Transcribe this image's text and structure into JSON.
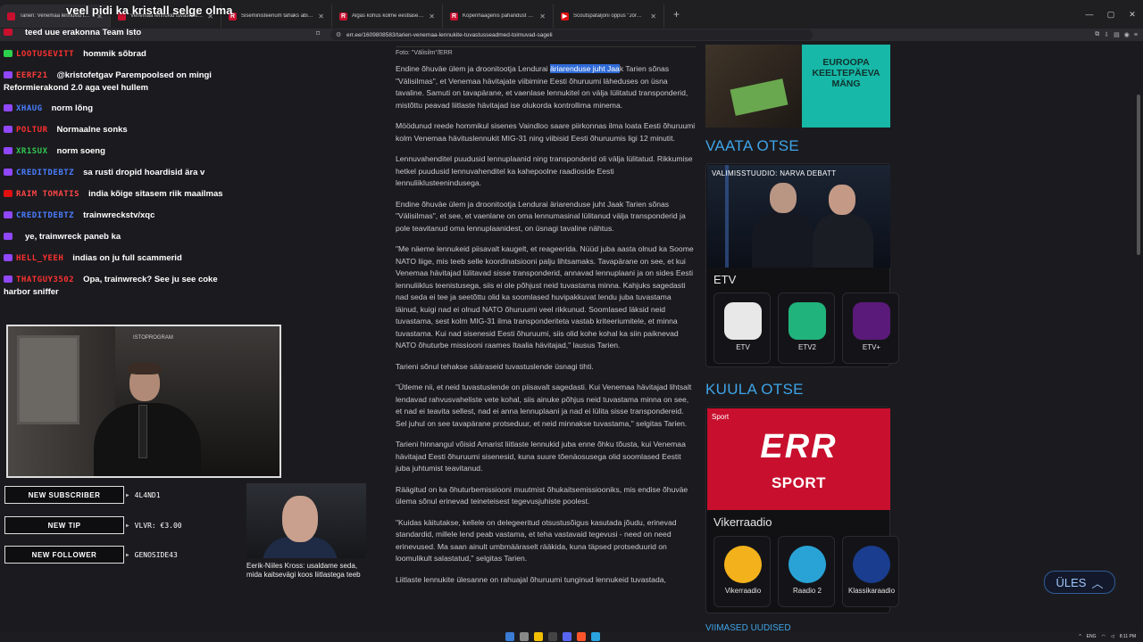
{
  "browser": {
    "tabs": [
      {
        "label": "Tarien: Venemaa lennukid tuvastusta",
        "fav_color": "#c8102e",
        "fav_glyph": ""
      },
      {
        "label": "Venemaa lennukid tuvastusta m",
        "fav_color": "#c8102e",
        "fav_glyph": ""
      },
      {
        "label": "Siseministeerium tahaks abipolitseinik",
        "fav_color": "#c8102e",
        "fav_glyph": "R"
      },
      {
        "label": "Algas kohus kolme eestlase üle, keda",
        "fav_color": "#c8102e",
        "fav_glyph": "R"
      },
      {
        "label": "Kopenhaagenis pahandust külvanud",
        "fav_color": "#c8102e",
        "fav_glyph": "R"
      },
      {
        "label": "Scoutspataljoni õppus \"Jörmungand\"",
        "fav_color": "#e01010",
        "fav_glyph": "▶"
      }
    ],
    "new_tab": "+",
    "url": "err.ee/1609808583/tarien-venemaa-lennukite-tuvastusseadmed-toimuvad-sageli"
  },
  "stream_overlay": {
    "top_message": "veel pidi ka kristall selge olma",
    "chat": [
      {
        "user": "",
        "msg": "teed uue erakonna Team Isto",
        "user_color": "#ff4545",
        "badge": "#c8102e"
      },
      {
        "user": "LOOTUSEVITT",
        "msg": "hommik sõbrad",
        "user_color": "#ff3030",
        "badge": "#2bd14a"
      },
      {
        "user": "EERF21",
        "msg": "@kristofetgav Parempoolsed on mingi Reformierakond 2.0 aga veel hullem",
        "user_color": "#ff3b3b",
        "badge": "#9147ff"
      },
      {
        "user": "XHAUG",
        "msg": "norm lõng",
        "user_color": "#4b7dff",
        "badge": "#9147ff"
      },
      {
        "user": "POLTUR",
        "msg": "Normaalne sonks",
        "user_color": "#ff3030",
        "badge": "#9147ff"
      },
      {
        "user": "XR1SUX",
        "msg": "norm soeng",
        "user_color": "#32c850",
        "badge": "#9147ff"
      },
      {
        "user": "CREDITDEBTZ",
        "msg": "sa rusti dropid hoardisid ära v",
        "user_color": "#4b7dff",
        "badge": "#9147ff"
      },
      {
        "user": "RAIM TOMATIS",
        "msg": "india kõige sitasem riik maailmas",
        "user_color": "#ff4545",
        "badge": "#e01010"
      },
      {
        "user": "CREDITDEBTZ",
        "msg": "trainwreckstv/xqc",
        "user_color": "#4b7dff",
        "badge": "#9147ff"
      },
      {
        "user": "",
        "msg": "ye, trainwreck paneb ka",
        "user_color": "#2f4bd8",
        "badge": "#9147ff"
      },
      {
        "user": "HELL_YEEH",
        "msg": "indias on ju full scammerid",
        "user_color": "#ff3030",
        "badge": "#9147ff"
      },
      {
        "user": "THATGUY3502",
        "msg": "Opa, trainwreck? See ju see coke harbor sniffer",
        "user_color": "#ff3030",
        "badge": "#9147ff"
      }
    ],
    "alerts": [
      {
        "label": "NEW SUBSCRIBER",
        "value": "4L4ND1"
      },
      {
        "label": "NEW TIP",
        "value": "VLVR: €3.00"
      },
      {
        "label": "NEW FOLLOWER",
        "value": "GENOSIDE43"
      }
    ],
    "cam_logo": "ISTOPROGRAM"
  },
  "news_thumb": {
    "caption": "Eerik-Niiles Kross: usaldame seda, mida kaitsevägi koos liitlastega teeb"
  },
  "article": {
    "photo_credit": "Foto: \"Välisilm\"/ERR",
    "lead_before": "Endine õhuväe ülem ja droonitootja Lendurai ",
    "lead_highlight": "äriarenduse juht Jaa",
    "lead_after": "k Tarien sõnas \"Välisilmas\", et Venemaa hävitajate viibimine Eesti õhuruumi läheduses on üsna tavaline. Samuti on tavapärane, et vaenlase lennukitel on välja lülitatud transponderid, mistõttu peavad liitlaste hävitajad ise olukorda kontrollima minema.",
    "paragraphs": [
      "Möödunud reede hommikul sisenes Vaindloo saare piirkonnas ilma loata Eesti õhuruumi kolm Venemaa hävituslennukit MIG-31 ning viibisid Eesti õhuruumis ligi 12 minutit.",
      "Lennuvahenditel puudusid lennuplaanid ning transponderid oli välja lülitatud. Rikkumise hetkel puudusid lennuvahenditel ka kahepoolne raadioside Eesti lennuliiklusteenindusega.",
      "Endine õhuväe ülem ja droonitootja Lendurai äriarenduse juht Jaak Tarien sõnas \"Välisilmas\", et see, et vaenlane on oma lennumasinal lülitanud välja transponderid ja pole teavitanud oma lennuplaanidest, on üsnagi tavaline nähtus.",
      "\"Me näeme lennukeid piisavalt kaugelt, et reageerida. Nüüd juba aasta olnud ka Soome NATO liige, mis teeb selle koordinatsiooni palju lihtsamaks. Tavapärane on see, et kui Venemaa hävitajad lülitavad sisse transponderid, annavad lennuplaani ja on sides Eesti lennuliiklus teenistusega, siis ei ole põhjust neid tuvastama minna. Kahjuks sagedasti nad seda ei tee ja seetõttu olid ka soomlased huvipakkuvat lendu juba tuvastama läinud, kuigi nad ei olnud NATO õhuruumi veel rikkunud. Soomlased läksid neid tuvastama, sest kolm MIG-31 ilma transponderiteta vastab kriteeriumitele, et minna tuvastama. Kui nad sisenesid Eesti õhuruumi, siis olid kohe kohal ka siin paiknevad NATO õhuturbe missiooni raames Itaalia hävitajad,\" lausus Tarien.",
      "Tarieni sõnul tehakse sääraseid tuvastuslende üsnagi tihti.",
      "\"Ütleme nii, et neid tuvastuslende on piisavalt sagedasti. Kui Venemaa hävitajad lihtsalt lendavad rahvusvaheliste vete kohal, siis ainuke põhjus neid tuvastama minna on see, et nad ei teavita sellest, nad ei anna lennuplaani ja nad ei lülita sisse transpondereid. Sel juhul on see tavapärane protseduur, et neid minnakse tuvastama,\" selgitas Tarien.",
      "Tarieni hinnangul võisid Amarist liitlaste lennukid juba enne õhku tõusta, kui Venemaa hävitajad Eesti õhuruumi sisenesid, kuna suure tõenäosusega olid soomlased Eestit juba juhtumist teavitanud.",
      "Räägitud on ka õhuturbemissiooni muutmist õhukaitsemissiooniks, mis endise õhuväe ülema sõnul erinevad teineteisest tegevusjuhiste poolest.",
      "\"Kuidas käitutakse, kellele on delegeeritud otsustusõigus kasutada jõudu, erinevad standardid, millele lend peab vastama, et teha vastavaid tegevusi - need on need erinevused. Ma saan ainult umbmääraselt rääkida, kuna täpsed protseduurid on loomulikult salastatud,\" selgitas Tarien.",
      "Liitlaste lennukite ülesanne on rahuajal õhuruumi tunginud lennukeid tuvastada,"
    ]
  },
  "sidebar": {
    "promo_text": "EUROOPA KEELTEPÄEVA MÄNG",
    "live_title": "VAATA OTSE",
    "live_video_label": "VALIMISSTUUDIO: NARVA DEBATT",
    "tv_group": "ETV",
    "tv_channels": [
      {
        "name": "ETV",
        "color": "#e8e8e8"
      },
      {
        "name": "ETV2",
        "color": "#21b37c"
      },
      {
        "name": "ETV+",
        "color": "#5a1a7a"
      }
    ],
    "radio_title": "KUULA OTSE",
    "radio_label": "Sport",
    "err_logo": "ERR",
    "err_sub": "SPORT",
    "radio_group": "Vikerraadio",
    "radio_channels": [
      {
        "name": "Vikerraadio",
        "color": "#f3b21b"
      },
      {
        "name": "Raadio 2",
        "color": "#29a3d6"
      },
      {
        "name": "Klassikaraadio",
        "color": "#1a3d8f"
      }
    ],
    "bottom_title": "VIIMASED UUDISED"
  },
  "scroll_top_button": "ÜLES",
  "taskbar": {
    "lang": "ENG",
    "time": "8:11 PM"
  }
}
